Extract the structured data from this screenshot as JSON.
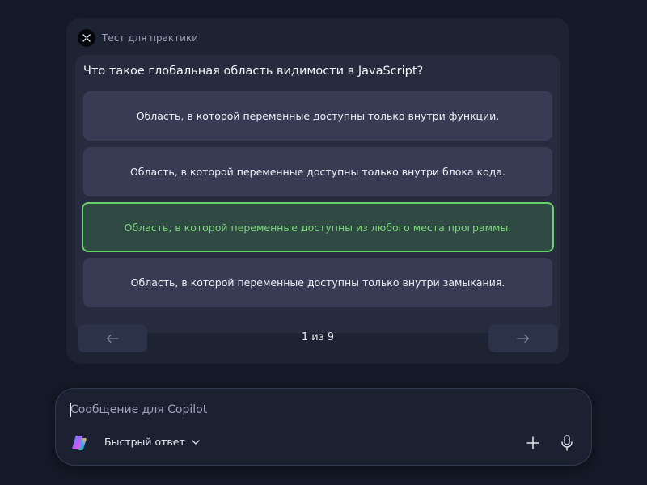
{
  "quiz": {
    "header_title": "Тест для практики",
    "question": "Что такое глобальная область видимости в JavaScript?",
    "options": [
      {
        "label": "Область, в которой переменные доступны только внутри функции.",
        "state": "default"
      },
      {
        "label": "Область, в которой переменные доступны только внутри блока кода.",
        "state": "default"
      },
      {
        "label": "Область, в которой переменные доступны из любого места программы.",
        "state": "correct"
      },
      {
        "label": "Область, в которой переменные доступны только внутри замыкания.",
        "state": "default"
      }
    ],
    "page_indicator": "1 из 9",
    "prev_icon": "arrow-left-icon",
    "next_icon": "arrow-right-icon"
  },
  "composer": {
    "placeholder": "Сообщение для Copilot",
    "mode_label": "Быстрый ответ",
    "icons": [
      "copilot-logo-icon",
      "chevron-down-icon",
      "plus-icon",
      "microphone-icon"
    ]
  },
  "colors": {
    "background": "#141a28",
    "card": "#1e2334",
    "option": "#373b53",
    "correct_border": "#6ccf6e",
    "correct_text": "#7fd67f"
  }
}
